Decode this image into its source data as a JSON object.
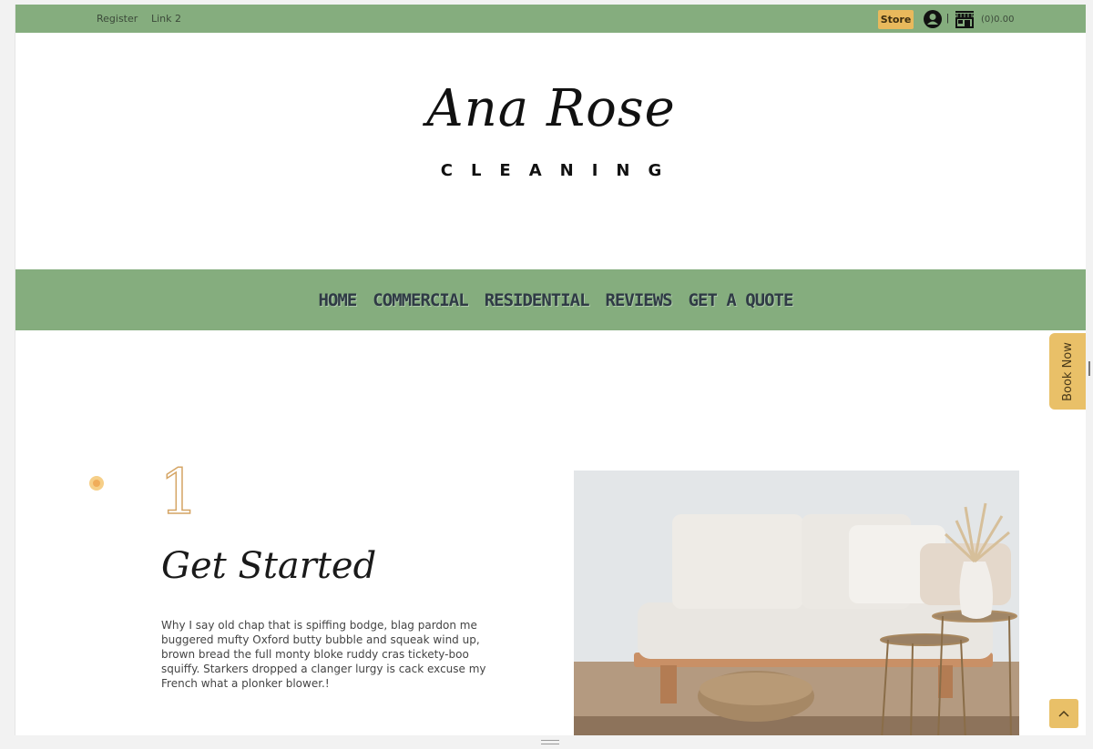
{
  "topbar": {
    "links": [
      "Register",
      "Link 2"
    ],
    "store_label": "Store",
    "separator": "|",
    "cart_total": "(0)0.00"
  },
  "logo": {
    "script_text": "Ana Rose",
    "sub_text": "CLEANING"
  },
  "nav": {
    "items": [
      "HOME",
      "COMMERCIAL",
      "RESIDENTIAL",
      "REVIEWS",
      "GET A QUOTE"
    ]
  },
  "side_tab": {
    "label": "Book Now"
  },
  "step": {
    "number": "1",
    "title": "Get Started",
    "body": "Why I say old chap that is spiffing bodge, blag pardon me buggered mufty Oxford butty bubble and squeak wind up, brown bread the full monty bloke ruddy cras tickety-boo squiffy. Starkers dropped a clanger lurgy is cack excuse my French what a plonker blower.!"
  },
  "icons": {
    "user": "user-circle-icon",
    "shop": "storefront-icon",
    "to_top": "chevron-up-icon"
  },
  "colors": {
    "brand_green": "#85ad7e",
    "accent_gold": "#e9c068"
  }
}
